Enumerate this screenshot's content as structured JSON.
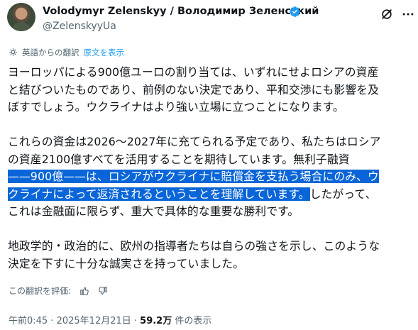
{
  "author": {
    "name": "Volodymyr Zelenskyy / Володимир Зеленський",
    "handle": "@ZelenskyyUa"
  },
  "translation": {
    "label": "英語からの翻訳",
    "show_original": "原文を表示"
  },
  "paragraphs": [
    {
      "lines": [
        "ヨーロッパによる900億ユーロの割り当ては、いずれにせよロシアの資産",
        "と結びついたものであり、前例のない決定であり、平和交渉にも影響を及",
        "ぼすでしょう。ウクライナはより強い立場に立つことになります。"
      ]
    },
    {
      "line1": "これらの資金は2026〜2027年に充てられる予定であり、私たちはロシア",
      "line2": "の資産2100億すべてを活用することを期待しています。無利子融資",
      "line3_selected": "——900億——は、ロシアがウクライナに賠償金を支払う場合にのみ、ウ",
      "line4_selected": "クライナによって返済されるということを理解しています。",
      "line4_rest": "したがって、",
      "line5": "これは金融面に限らず、重大で具体的な重要な勝利です。"
    },
    {
      "lines": [
        "地政学的・政治的に、欧州の指導者たちは自らの強さを示し、このような",
        "決定を下すに十分な誠実さを持っていました。"
      ]
    }
  ],
  "rate_translation": "この翻訳を評価:",
  "meta": {
    "time": "午前0:45 · 2025年12月21日 · ",
    "views": "59.2万",
    "views_suffix": " 件の表示"
  },
  "colors": {
    "accent": "#1d9bf0",
    "selection": "#0a66d8",
    "secondary_text": "#536471"
  },
  "icons": [
    "verified-badge-icon",
    "grok-icon",
    "more-icon",
    "translate-icon",
    "thumbs-up-icon",
    "thumbs-down-icon"
  ]
}
